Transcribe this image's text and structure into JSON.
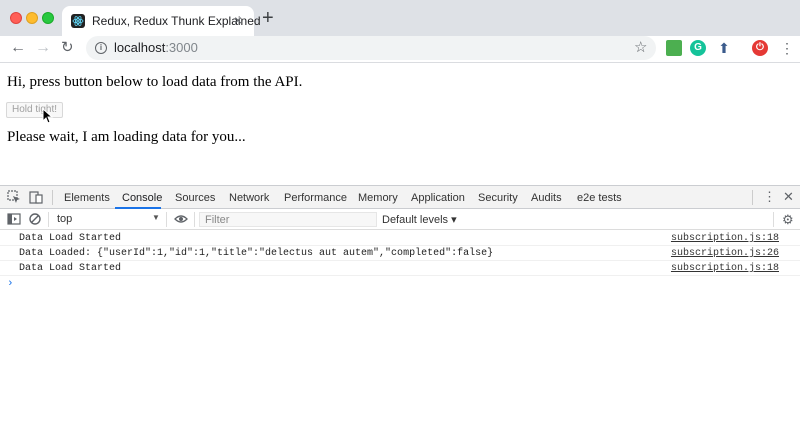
{
  "browser": {
    "tab_title": "Redux, Redux Thunk Explained",
    "tab_close": "×",
    "new_tab": "+",
    "url_host": "localhost",
    "url_port": ":3000",
    "star": "☆"
  },
  "page": {
    "greeting": "Hi, press button below to load data from the API.",
    "button_label": "Hold tight!",
    "wait_message": "Please wait, I am loading data for you..."
  },
  "devtools": {
    "tabs": [
      "Elements",
      "Console",
      "Sources",
      "Network",
      "Performance",
      "Memory",
      "Application",
      "Security",
      "Audits",
      "e2e tests"
    ],
    "active_tab": "Console",
    "context": "top",
    "filter_placeholder": "Filter",
    "levels": "Default levels ▾",
    "logs": [
      {
        "message": "Data Load Started",
        "source": "subscription.js:18"
      },
      {
        "message": "Data Loaded: {\"userId\":1,\"id\":1,\"title\":\"delectus aut autem\",\"completed\":false}",
        "source": "subscription.js:26"
      },
      {
        "message": "Data Load Started",
        "source": "subscription.js:18"
      }
    ],
    "prompt": "›"
  },
  "colors": {
    "accent": "#1a73e8",
    "close_red": "#ff5f57",
    "minimize_yellow": "#febc2e",
    "maximize_green": "#28c840"
  }
}
